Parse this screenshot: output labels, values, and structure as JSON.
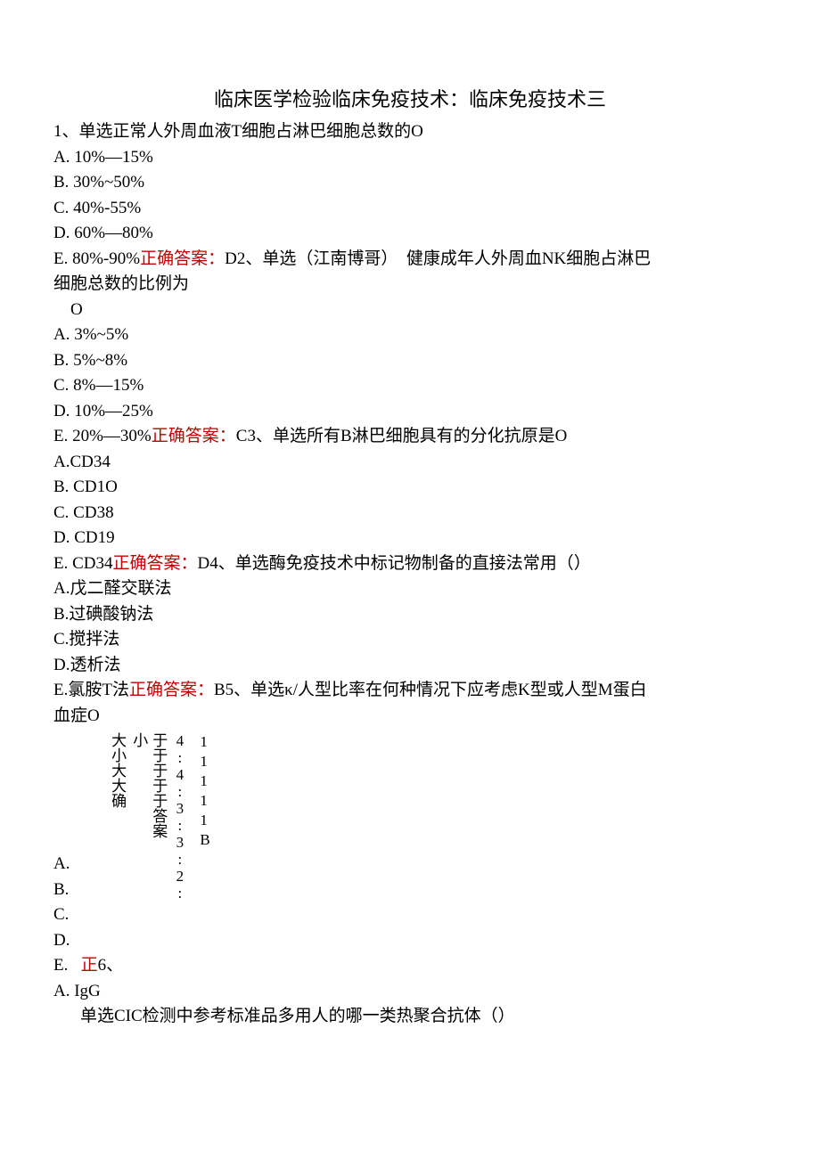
{
  "title": "临床医学检验临床免疫技术：临床免疫技术三",
  "q1": {
    "stem": "1、单选正常人外周血液T细胞占淋巴细胞总数的O",
    "a": "A. 10%—15%",
    "b": "B. 30%~50%",
    "c": "C. 40%-55%",
    "d": "D. 60%—80%",
    "e_pre": "E. 80%-90%",
    "e_ans": "正确答案：",
    "e_post": "D2、单选（江南博哥）　健康成年人外周血NK细胞占淋巴"
  },
  "cont1": "细胞总数的比例为",
  "o_marker": "O",
  "q2": {
    "a": "A. 3%~5%",
    "b": "B. 5%~8%",
    "c": "C. 8%—15%",
    "d": "D. 10%—25%",
    "e_pre": "E. 20%—30%",
    "e_ans": "正确答案：",
    "e_post": "C3、单选所有B淋巴细胞具有的分化抗原是O"
  },
  "q3": {
    "a": "A.CD34",
    "b": "B. CD1O",
    "c": "C. CD38",
    "d": "D. CD19",
    "e_pre": "E. CD34",
    "e_ans": "正确答案：",
    "e_post": "D4、单选酶免疫技术中标记物制备的直接法常用（）"
  },
  "q4": {
    "a": "A.戊二醛交联法",
    "b": "B.过碘酸钠法",
    "c": "C.搅拌法",
    "d": "D.透析法",
    "e_pre": "E.氯胺T法",
    "e_ans": "正确答案：",
    "e_post": "B5、单选κ/人型比率在何种情况下应考虑K型或人型M蛋白"
  },
  "cont4": "血症O",
  "q5": {
    "v1": "大小大大确",
    "v2": "于于于于于答案",
    "v3": "4:4:3:3:2:",
    "v4": "小",
    "r1": "1",
    "r2": "1",
    "r3": "1",
    "r4": "1",
    "r5": "1",
    "r6": "B",
    "a": "A.",
    "b": "B.",
    "c": "C.",
    "d": "D.",
    "e": "E.",
    "e_ans": "正",
    "e_post": "6、"
  },
  "q6": {
    "a": "A. IgG",
    "stem": "单选CIC检测中参考标准品多用人的哪一类热聚合抗体（）"
  }
}
